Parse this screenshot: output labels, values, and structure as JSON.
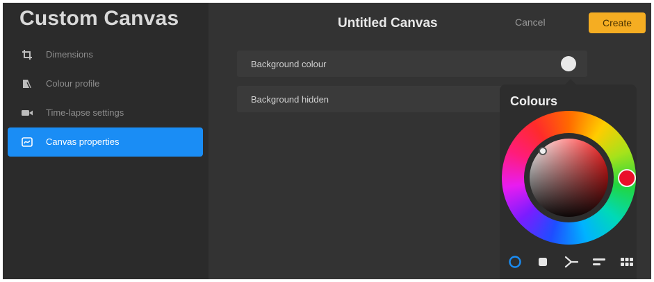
{
  "sidebar": {
    "title": "Custom Canvas",
    "items": [
      {
        "label": "Dimensions",
        "icon": "crop-icon"
      },
      {
        "label": "Colour profile",
        "icon": "colour-profile-icon"
      },
      {
        "label": "Time-lapse settings",
        "icon": "video-camera-icon"
      },
      {
        "label": "Canvas properties",
        "icon": "canvas-properties-icon",
        "active": true
      }
    ]
  },
  "header": {
    "title": "Untitled Canvas",
    "cancel_label": "Cancel",
    "create_label": "Create"
  },
  "properties": {
    "background_colour_label": "Background colour",
    "background_colour_value": "#e9e9e9",
    "background_hidden_label": "Background hidden"
  },
  "colour_panel": {
    "title": "Colours",
    "selected_hue": "#ea0f2a",
    "mode_tabs": [
      {
        "name": "disc",
        "icon": "disc-icon",
        "active": true
      },
      {
        "name": "classic",
        "icon": "classic-icon"
      },
      {
        "name": "harmony",
        "icon": "harmony-icon"
      },
      {
        "name": "value",
        "icon": "value-icon"
      },
      {
        "name": "palettes",
        "icon": "palettes-icon"
      }
    ]
  },
  "colors": {
    "accent": "#1a8df5",
    "create_button": "#f5ad22"
  }
}
